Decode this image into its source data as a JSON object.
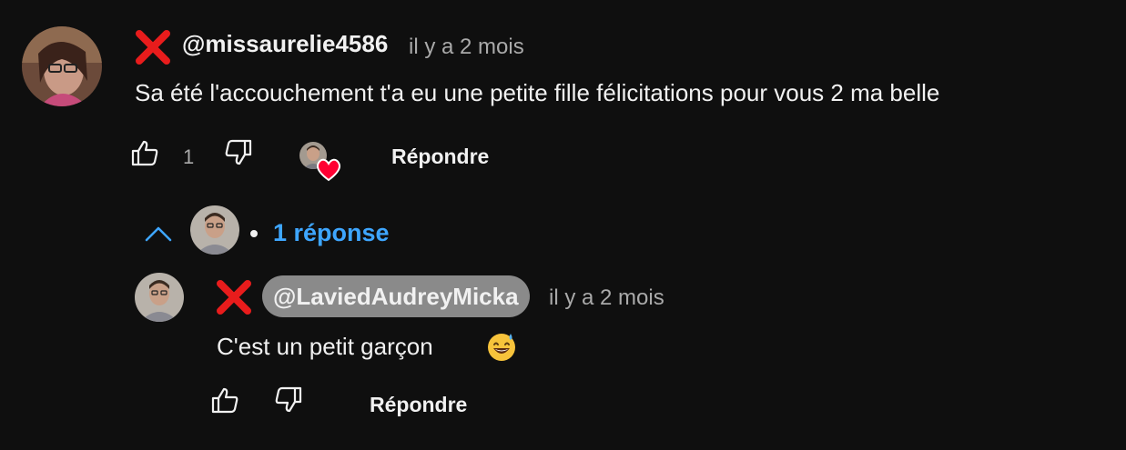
{
  "comment": {
    "handle": "@missaurelie4586",
    "time": "il y a 2 mois",
    "text": "Sa été l'accouchement t'a eu une petite fille félicitations pour vous 2 ma belle",
    "like_count": "1",
    "reply_label": "Répondre",
    "badge_icon": "red-cross-mark",
    "heart_color": "#ff0033"
  },
  "replies_toggle": {
    "label": "1 réponse",
    "color": "#3ea6ff"
  },
  "reply": {
    "handle": "@LaviedAudreyMicka",
    "time": "il y a 2 mois",
    "text": "C'est un petit garçon",
    "emoji": "grinning-face-with-sweat",
    "reply_label": "Répondre",
    "badge_icon": "red-cross-mark"
  }
}
